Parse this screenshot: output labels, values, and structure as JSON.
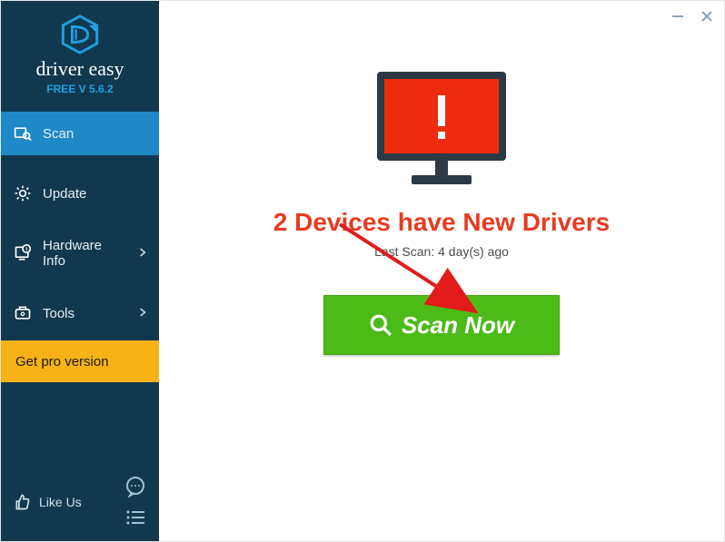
{
  "brand": {
    "name": "driver easy",
    "version": "FREE V 5.6.2"
  },
  "sidebar": {
    "items": [
      {
        "label": "Scan",
        "icon": "scan",
        "active": true,
        "hasSub": false
      },
      {
        "label": "Update",
        "icon": "gear",
        "active": false,
        "hasSub": false
      },
      {
        "label": "Hardware Info",
        "icon": "hwinfo",
        "active": false,
        "hasSub": true
      },
      {
        "label": "Tools",
        "icon": "tools",
        "active": false,
        "hasSub": true
      }
    ],
    "pro_label": "Get pro version",
    "like_label": "Like Us"
  },
  "main": {
    "headline": "2 Devices have New Drivers",
    "last_scan": "Last Scan: 4 day(s) ago",
    "scan_button": "Scan Now"
  }
}
